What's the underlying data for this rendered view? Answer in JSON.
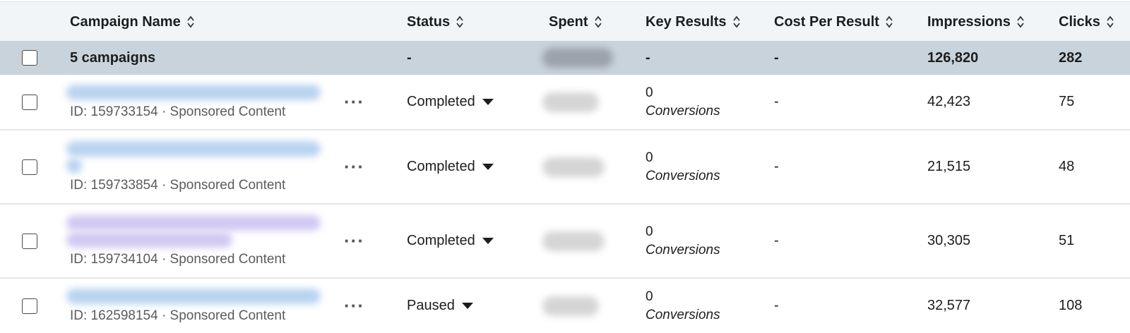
{
  "header": {
    "campaign_name": "Campaign Name",
    "status": "Status",
    "spent": "Spent",
    "key_results": "Key Results",
    "cost_per_result": "Cost Per Result",
    "impressions": "Impressions",
    "clicks": "Clicks"
  },
  "summary": {
    "label": "5 campaigns",
    "status": "-",
    "key_results": "-",
    "cost_per_result": "-",
    "impressions": "126,820",
    "clicks": "282"
  },
  "rows": [
    {
      "id_line": "ID: 159733154 · Sponsored Content",
      "more": "···",
      "status": "Completed",
      "key_results_value": "0",
      "key_results_unit": "Conversions",
      "cost_per_result": "-",
      "impressions": "42,423",
      "clicks": "75"
    },
    {
      "id_line": "ID: 159733854 · Sponsored Content",
      "more": "···",
      "status": "Completed",
      "key_results_value": "0",
      "key_results_unit": "Conversions",
      "cost_per_result": "-",
      "impressions": "21,515",
      "clicks": "48"
    },
    {
      "id_line": "ID: 159734104 · Sponsored Content",
      "more": "···",
      "status": "Completed",
      "key_results_value": "0",
      "key_results_unit": "Conversions",
      "cost_per_result": "-",
      "impressions": "30,305",
      "clicks": "51"
    },
    {
      "id_line": "ID: 162598154 · Sponsored Content",
      "more": "···",
      "status": "Paused",
      "key_results_value": "0",
      "key_results_unit": "Conversions",
      "cost_per_result": "-",
      "impressions": "32,577",
      "clicks": "108"
    }
  ],
  "icons": {
    "sort": "sort-chevrons-icon",
    "status_dropdown": "caret-down-icon",
    "more": "more-horizontal-icon"
  },
  "colors": {
    "header_bg": "#f2f5f8",
    "summary_bg": "#c9d3db",
    "link_blue_blurred": "#b9d3f0"
  }
}
